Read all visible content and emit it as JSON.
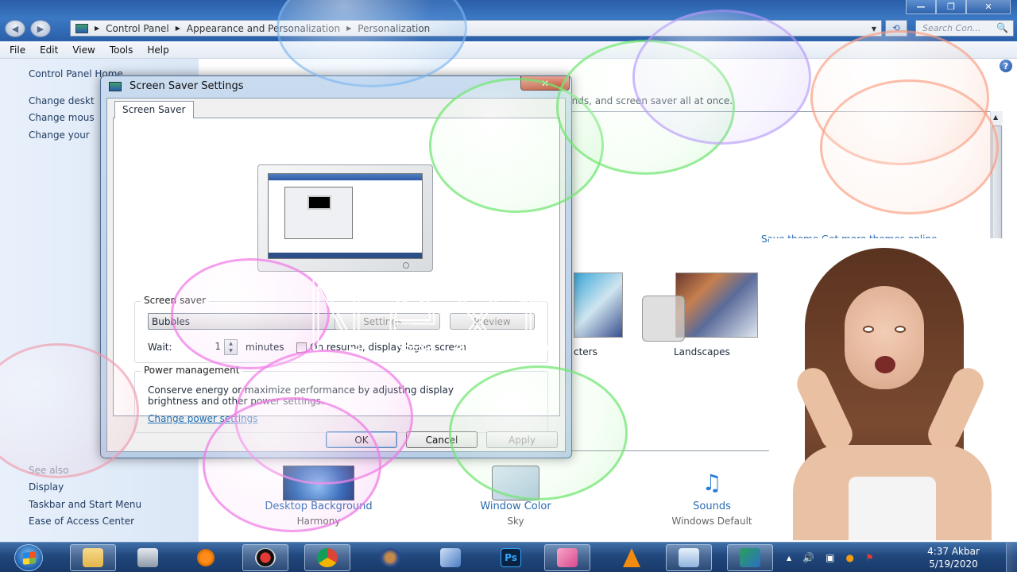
{
  "window": {
    "controls": {
      "minimize": "—",
      "maximize": "❐",
      "close": "✕"
    },
    "back_icon": "back-arrow-icon",
    "forward_icon": "forward-arrow-icon",
    "address": {
      "crumbs": [
        "Control Panel",
        "Appearance and Personalization",
        "Personalization"
      ]
    },
    "search": {
      "placeholder": "Search Con...",
      "icon": "🔍"
    },
    "refresh_icon": "⟲"
  },
  "menubar": {
    "items": [
      "File",
      "Edit",
      "View",
      "Tools",
      "Help"
    ]
  },
  "sidebar": {
    "home": "Control Panel Home",
    "links": [
      "Change desktop icons",
      "Change mouse pointers",
      "Change your account picture"
    ],
    "links_visible": [
      "Change deskt",
      "Change mous",
      "Change your"
    ],
    "see_also_label": "See also",
    "see_also": [
      "Display",
      "Taskbar and Start Menu",
      "Ease of Access Center"
    ]
  },
  "content": {
    "intro_visible": "unds, and screen saver all at once.",
    "save_links_visible": "Save theme    Get more themes online",
    "themes": [
      {
        "label": "cters"
      },
      {
        "label": "Landscapes"
      }
    ],
    "bottom": [
      {
        "label": "Desktop Background",
        "sub": "Harmony"
      },
      {
        "label": "Window Color",
        "sub": "Sky"
      },
      {
        "label": "Sounds",
        "sub": "Windows Default"
      }
    ],
    "help_icon": "?"
  },
  "dialog": {
    "title": "Screen Saver Settings",
    "close": "✕",
    "tab": "Screen Saver",
    "screen_saver_group": "Screen saver",
    "selected": "Bubbles",
    "settings_btn": "Settings...",
    "preview_btn": "Preview",
    "wait_label": "Wait:",
    "wait_value": "1",
    "minutes_label": "minutes",
    "logon_label": "On resume, display logon screen",
    "logon_checked": false,
    "power_group": "Power management",
    "power_text": "Conserve energy or maximize performance by adjusting display brightness and other power settings.",
    "power_link": "Change power settings",
    "ok": "OK",
    "cancel": "Cancel",
    "apply": "Apply"
  },
  "overlay": {
    "text": "Next"
  },
  "taskbar": {
    "start_icon": "windows-start-icon",
    "items": [
      {
        "name": "explorer",
        "open": true
      },
      {
        "name": "media-center",
        "open": false
      },
      {
        "name": "media-player",
        "open": false
      },
      {
        "name": "screen-recorder",
        "open": true
      },
      {
        "name": "chrome",
        "open": true
      },
      {
        "name": "photo-app",
        "open": false
      },
      {
        "name": "network-app",
        "open": false
      },
      {
        "name": "photoshop",
        "open": false
      },
      {
        "name": "image-viewer",
        "open": true
      },
      {
        "name": "vlc",
        "open": false
      },
      {
        "name": "control-panel",
        "open": true
      },
      {
        "name": "personalization",
        "open": true
      }
    ],
    "tray": {
      "expand": "▲",
      "volume": "🔊",
      "network": "▣",
      "app": "●",
      "action_center": "⚑"
    },
    "clock": {
      "time": "4:37 Akbar",
      "date": "5/19/2020"
    }
  },
  "colors": {
    "accent_blue": "#2a6bb0",
    "titlebar": "#2b5ea8",
    "taskbar": "#21477c"
  }
}
